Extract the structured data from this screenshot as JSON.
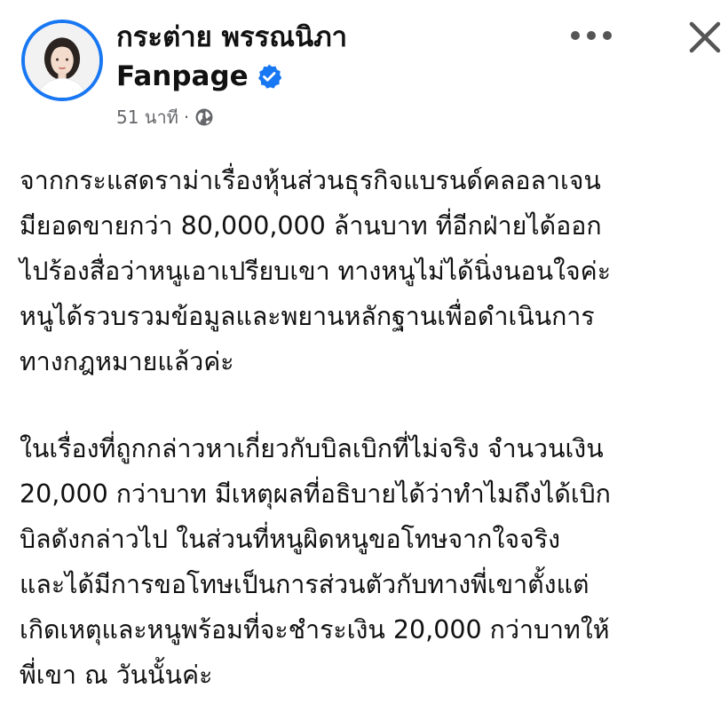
{
  "post": {
    "author_name": "กระต่าย พรรณนิภา",
    "author_sub": "Fanpage",
    "time_ago": "51 นาที",
    "separator": "·",
    "body": [
      "จากกระแสดราม่าเรื่องหุ้นส่วนธุรกิจแบรนด์คลอลาเจน\nมียอดขายกว่า 80,000,000 ล้านบาท ที่อีกฝ่ายได้ออก\nไปร้องสื่อว่าหนูเอาเปรียบเขา ทางหนูไม่ได้นิ่งนอนใจค่ะ\nหนูได้รวบรวมข้อมูลและพยานหลักฐานเพื่อดำเนินการ\nทางกฎหมายแล้วค่ะ",
      "ในเรื่องที่ถูกกล่าวหาเกี่ยวกับบิลเบิกที่ไม่จริง จำนวนเงิน\n20,000 กว่าบาท มีเหตุผลที่อธิบายได้ว่าทำไมถึงได้เบิก\nบิลดังกล่าวไป ในส่วนที่หนูผิดหนูขอโทษจากใจจริง\nและได้มีการขอโทษเป็นการส่วนตัวกับทางพี่เขาตั้งแต่\nเกิดเหตุและหนูพร้อมที่จะชำระเงิน 20,000 กว่าบาทให้\nพี่เขา ณ วันนั้นค่ะ"
    ]
  },
  "icons": {
    "verified": "verified-badge-icon",
    "audience": "globe-icon",
    "more": "more-options-icon",
    "close": "close-icon"
  },
  "colors": {
    "accent": "#1877f2",
    "meta_text": "#65676b",
    "body_text": "#111111",
    "icon": "#555555"
  }
}
